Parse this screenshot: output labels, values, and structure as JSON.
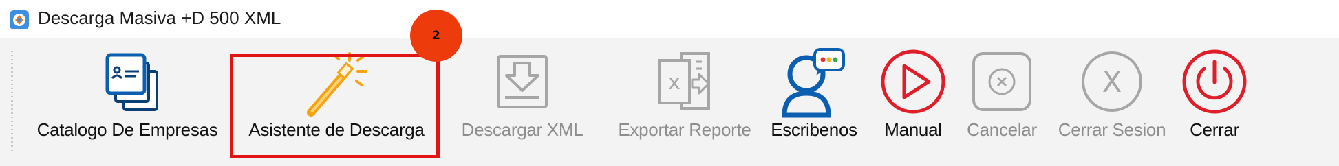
{
  "window": {
    "title": "Descarga Masiva +D 500 XML",
    "icon": "app-logo-icon"
  },
  "toolbar": {
    "items": [
      {
        "label": "Catalogo De Empresas",
        "icon": "company-catalog-icon",
        "enabled": true
      },
      {
        "label": "Asistente de Descarga",
        "icon": "magic-wand-icon",
        "enabled": true
      },
      {
        "label": "Descargar XML",
        "icon": "download-icon",
        "enabled": false
      },
      {
        "label": "Exportar Reporte",
        "icon": "export-excel-icon",
        "enabled": false
      },
      {
        "label": "Escribenos",
        "icon": "chat-user-icon",
        "enabled": true
      },
      {
        "label": "Manual",
        "icon": "play-icon",
        "enabled": true
      },
      {
        "label": "Cancelar",
        "icon": "cancel-icon",
        "enabled": false
      },
      {
        "label": "Cerrar Sesion",
        "icon": "logout-x-icon",
        "enabled": false
      },
      {
        "label": "Cerrar",
        "icon": "power-icon",
        "enabled": true
      }
    ]
  },
  "annotation": {
    "step_number": "2",
    "highlight_color": "#e21414",
    "badge_color": "#ee3b0b"
  },
  "colors": {
    "accent_blue": "#0c5fb0",
    "accent_red": "#e01e2a",
    "disabled_gray": "#a6a6a6",
    "wand_orange": "#f2a413"
  }
}
